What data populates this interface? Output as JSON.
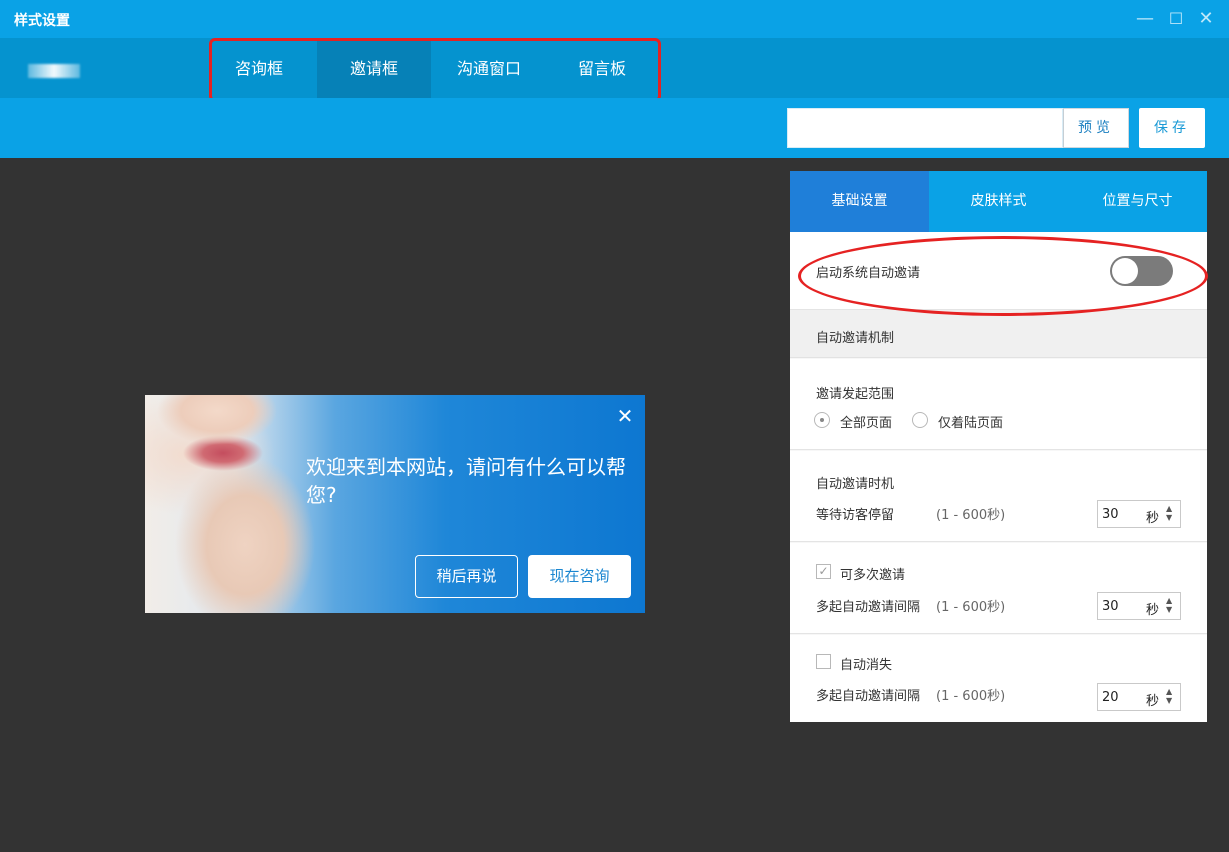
{
  "window": {
    "title": "样式设置",
    "controls": {
      "minimize": "—",
      "maximize": "☐",
      "close": "✕"
    }
  },
  "nav": {
    "tabs": [
      {
        "label": "咨询框"
      },
      {
        "label": "邀请框"
      },
      {
        "label": "沟通窗口"
      },
      {
        "label": "留言板"
      }
    ],
    "active": "邀请框"
  },
  "toolbar": {
    "search_value": "",
    "preview_label": "预览",
    "save_label": "保存"
  },
  "invite_popup": {
    "message": "欢迎来到本网站，请问有什么可以帮您?",
    "later_label": "稍后再说",
    "consult_label": "现在咨询",
    "close_glyph": "✕"
  },
  "panel": {
    "tabs": [
      {
        "label": "基础设置"
      },
      {
        "label": "皮肤样式"
      },
      {
        "label": "位置与尺寸"
      }
    ],
    "auto_invite_label": "启动系统自动邀请",
    "auto_invite_on": false,
    "mechanism_header": "自动邀请机制",
    "scope": {
      "title": "邀请发起范围",
      "options": [
        {
          "label": "全部页面",
          "checked": true
        },
        {
          "label": "仅着陆页面",
          "checked": false
        }
      ]
    },
    "timing": {
      "title": "自动邀请时机",
      "desc": "等待访客停留",
      "range": "(1 - 600秒)",
      "value": "30",
      "unit": "秒"
    },
    "multi": {
      "title": "可多次邀请",
      "checked": true,
      "desc": "多起自动邀请间隔",
      "range": "(1 - 600秒)",
      "value": "30",
      "unit": "秒"
    },
    "dismiss": {
      "title": "自动消失",
      "checked": false,
      "desc": "多起自动邀请间隔",
      "range": "(1 - 600秒)",
      "value": "20",
      "unit": "秒"
    }
  },
  "colors": {
    "titlebar": "#0aa2e6",
    "navbar": "#0593cf",
    "nav_active": "#0681b7",
    "canvas": "#333333",
    "panel_tab_active": "#1f7fd9",
    "annotation": "#e52222"
  }
}
